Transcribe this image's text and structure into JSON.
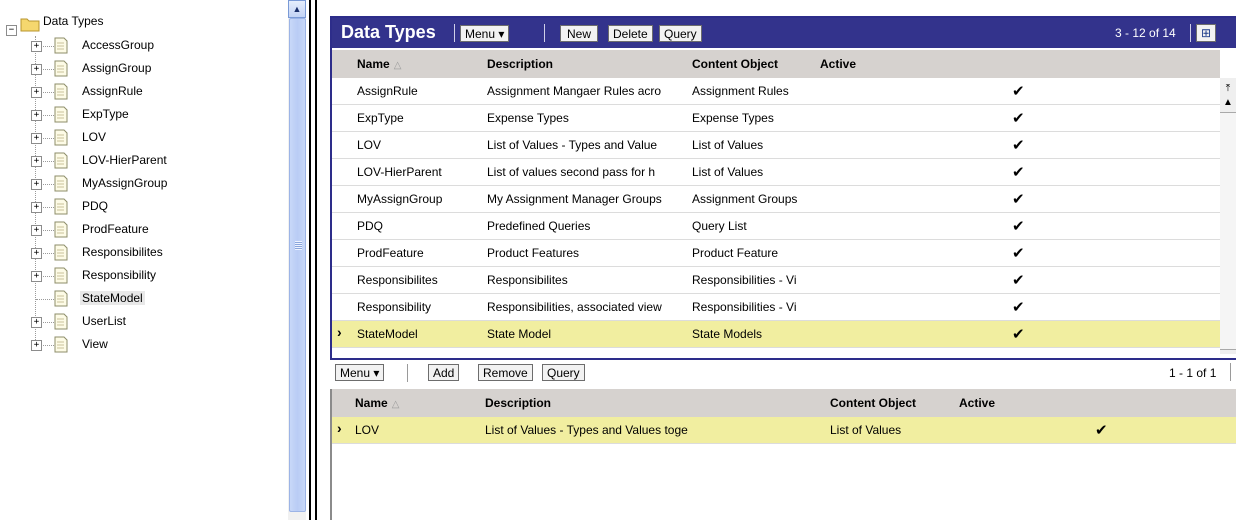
{
  "tree": {
    "root": "Data Types",
    "items": [
      {
        "label": "AccessGroup",
        "expandable": true
      },
      {
        "label": "AssignGroup",
        "expandable": true
      },
      {
        "label": "AssignRule",
        "expandable": true
      },
      {
        "label": "ExpType",
        "expandable": true
      },
      {
        "label": "LOV",
        "expandable": true
      },
      {
        "label": "LOV-HierParent",
        "expandable": true
      },
      {
        "label": "MyAssignGroup",
        "expandable": true
      },
      {
        "label": "PDQ",
        "expandable": true
      },
      {
        "label": "ProdFeature",
        "expandable": true
      },
      {
        "label": "Responsibilites",
        "expandable": true
      },
      {
        "label": "Responsibility",
        "expandable": true
      },
      {
        "label": "StateModel",
        "expandable": false,
        "selected": true
      },
      {
        "label": "UserList",
        "expandable": true
      },
      {
        "label": "View",
        "expandable": true
      }
    ]
  },
  "main": {
    "title": "Data Types",
    "menu_label": "Menu ▾",
    "new_label": "New",
    "delete_label": "Delete",
    "query_label": "Query",
    "record_count": "3 - 12 of 14",
    "columns": [
      "Name",
      "Description",
      "Content Object",
      "Active"
    ],
    "rows": [
      {
        "name": "AssignRule",
        "description": "Assignment Mangaer Rules acro",
        "content": "Assignment Rules",
        "active": true
      },
      {
        "name": "ExpType",
        "description": "Expense Types",
        "content": "Expense Types",
        "active": true
      },
      {
        "name": "LOV",
        "description": "List of Values - Types and Value",
        "content": "List of Values",
        "active": true
      },
      {
        "name": "LOV-HierParent",
        "description": "List of values second pass for h",
        "content": "List of Values",
        "active": true
      },
      {
        "name": "MyAssignGroup",
        "description": "My Assignment Manager Groups",
        "content": "Assignment Groups",
        "active": true
      },
      {
        "name": "PDQ",
        "description": "Predefined Queries",
        "content": "Query List",
        "active": true
      },
      {
        "name": "ProdFeature",
        "description": "Product Features",
        "content": "Product Feature",
        "active": true
      },
      {
        "name": "Responsibilites",
        "description": "Responsibilites",
        "content": "Responsibilities - Vi",
        "active": true
      },
      {
        "name": "Responsibility",
        "description": "Responsibilities, associated view",
        "content": "Responsibilities - Vi",
        "active": true
      },
      {
        "name": "StateModel",
        "description": "State Model",
        "content": "State Models",
        "active": true,
        "selected": true
      }
    ]
  },
  "lower": {
    "menu_label": "Menu ▾",
    "add_label": "Add",
    "remove_label": "Remove",
    "query_label": "Query",
    "record_count": "1 - 1 of 1",
    "columns": [
      "Name",
      "Description",
      "Content Object",
      "Active"
    ],
    "rows": [
      {
        "name": "LOV",
        "description": "List of Values - Types and Values together",
        "content": "List of Values",
        "active": true,
        "selected": true
      }
    ]
  },
  "glyphs": {
    "check": "✔",
    "row_marker": "›",
    "sort_indicator": "△"
  },
  "colors": {
    "title_bar": "#33338c",
    "header_bg": "#d6d2cf",
    "selected_row": "#f1eea0"
  }
}
